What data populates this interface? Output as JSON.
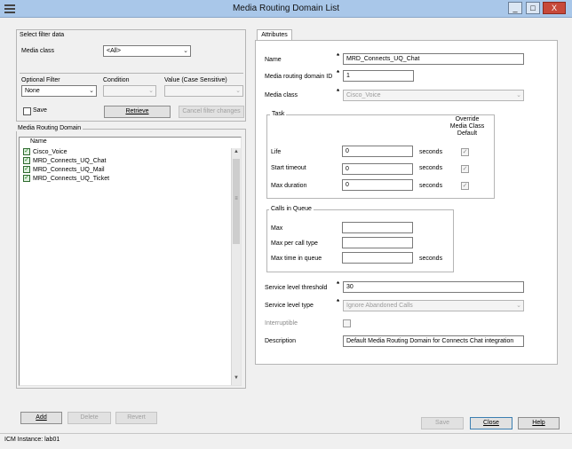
{
  "window": {
    "title": "Media Routing Domain List",
    "minimize": "_",
    "maximize": "□",
    "close": "X"
  },
  "filter": {
    "group_title": "Select filter data",
    "media_class_label": "Media class",
    "media_class_value": "<All>",
    "optional_filter_label": "Optional Filter",
    "optional_filter_value": "None",
    "condition_label": "Condition",
    "condition_value": "",
    "value_label": "Value (Case Sensitive)",
    "value_value": "",
    "save_label": "Save",
    "retrieve_label": "Retrieve",
    "cancel_filter_label": "Cancel filter changes"
  },
  "list": {
    "group_title": "Media Routing Domain",
    "column_header": "Name",
    "items": [
      "Cisco_Voice",
      "MRD_Connects_UQ_Chat",
      "MRD_Connects_UQ_Mail",
      "MRD_Connects_UQ_Ticket"
    ],
    "scroll_up": "▲",
    "scroll_down": "▼",
    "thumb_grip": "≡",
    "check_glyph": "✓"
  },
  "left_buttons": {
    "add": "Add",
    "delete": "Delete",
    "revert": "Revert"
  },
  "attributes": {
    "tab_label": "Attributes",
    "required_mark": "*",
    "name_label": "Name",
    "name_value": "MRD_Connects_UQ_Chat",
    "mrd_id_label": "Media routing domain ID",
    "mrd_id_value": "1",
    "media_class_label": "Media class",
    "media_class_value": "Cisco_Voice",
    "task": {
      "title": "Task",
      "override_header": "Override Media Class Default",
      "life_label": "Life",
      "life_value": "0",
      "start_timeout_label": "Start timeout",
      "start_timeout_value": "0",
      "max_duration_label": "Max duration",
      "max_duration_value": "0",
      "unit": "seconds"
    },
    "calls_in_queue": {
      "title": "Calls in Queue",
      "max_label": "Max",
      "max_value": "",
      "max_per_call_type_label": "Max per call type",
      "max_per_call_type_value": "",
      "max_time_label": "Max time in queue",
      "max_time_value": "",
      "unit": "seconds"
    },
    "service_level_threshold_label": "Service level threshold",
    "service_level_threshold_value": "30",
    "service_level_type_label": "Service level type",
    "service_level_type_value": "Ignore Abandoned Calls",
    "interruptible_label": "Interruptible",
    "description_label": "Description",
    "description_value": "Default Media Routing Domain for Connects Chat integration",
    "dropdown_glyph": "⌄",
    "check_glyph": "✓"
  },
  "bottom_buttons": {
    "save": "Save",
    "close": "Close",
    "help": "Help"
  },
  "status": {
    "text": "ICM Instance: lab01"
  }
}
